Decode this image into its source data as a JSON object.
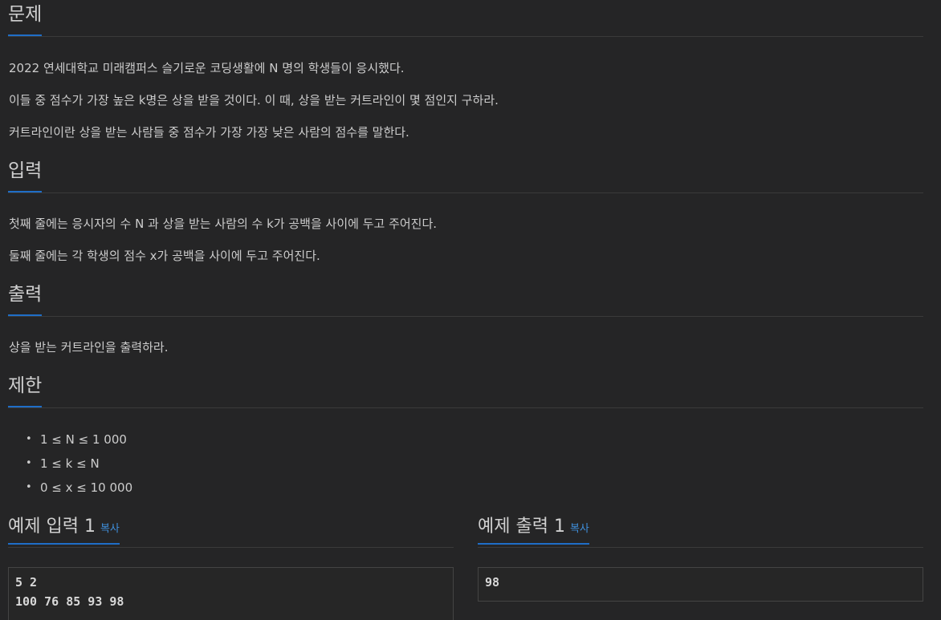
{
  "sections": {
    "problem": {
      "heading": "문제",
      "lines": [
        "2022 연세대학교 미래캠퍼스 슬기로운 코딩생활에 N 명의 학생들이 응시했다.",
        "이들 중 점수가 가장 높은 k명은 상을 받을 것이다. 이 때, 상을 받는 커트라인이 몇 점인지 구하라.",
        "커트라인이란 상을 받는 사람들 중 점수가 가장 가장 낮은 사람의 점수를 말한다."
      ]
    },
    "input": {
      "heading": "입력",
      "lines": [
        "첫째 줄에는 응시자의 수 N 과 상을 받는 사람의 수 k가 공백을 사이에 두고 주어진다.",
        "둘째 줄에는 각 학생의 점수 x가 공백을 사이에 두고 주어진다."
      ]
    },
    "output": {
      "heading": "출력",
      "lines": [
        "상을 받는 커트라인을 출력하라."
      ]
    },
    "limits": {
      "heading": "제한",
      "items": [
        "1 ≤ N  ≤ 1 000",
        "1 ≤ k ≤ N",
        "0 ≤ x  ≤ 10 000"
      ]
    }
  },
  "examples": {
    "input": {
      "title": "예제 입력 1",
      "copy_label": "복사",
      "content": "5 2\n100 76 85 93 98"
    },
    "output": {
      "title": "예제 출력 1",
      "copy_label": "복사",
      "content": "98"
    }
  },
  "colors": {
    "background": "#252526",
    "accent": "#1f6ec7",
    "link": "#3f8fdb"
  }
}
